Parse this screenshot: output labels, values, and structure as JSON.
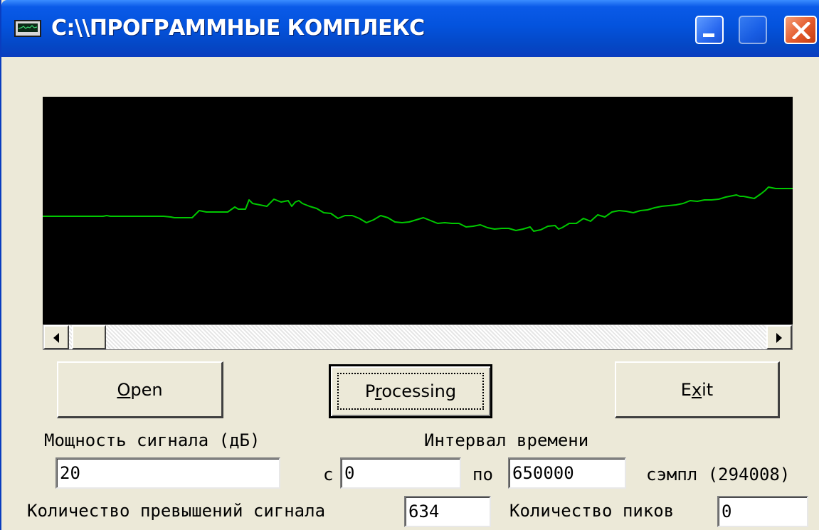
{
  "window": {
    "title": "C:\\\\ПРОГРАММНЫЕ КОМПЛЕКС",
    "icons": {
      "app": "monitor-icon",
      "minimize": "minimize-icon",
      "maximize": "maximize-icon",
      "close": "close-icon"
    },
    "colors": {
      "titlebar": "#0453dd",
      "face": "#ece9d8",
      "close_button": "#e45a2c"
    }
  },
  "plot": {
    "background": "#000000",
    "line_color": "#00c800"
  },
  "chart_data": {
    "type": "line",
    "title": "",
    "xlabel": "",
    "ylabel": "",
    "grid": false,
    "x": [
      0,
      85,
      90,
      95,
      100,
      170,
      180,
      185,
      210,
      220,
      230,
      260,
      270,
      275,
      285,
      290,
      295,
      305,
      315,
      325,
      335,
      345,
      350,
      355,
      360,
      365,
      370,
      375,
      385,
      395,
      405,
      415,
      425,
      435,
      445,
      455,
      465,
      475,
      485,
      495,
      505,
      515,
      525,
      535,
      545,
      555,
      565,
      575,
      585,
      595,
      605,
      615,
      625,
      635,
      645,
      655,
      665,
      675,
      685,
      690,
      700,
      710,
      720,
      725,
      730,
      740,
      750,
      760,
      770,
      780,
      790,
      800,
      810,
      820,
      830,
      840,
      850,
      860,
      870,
      880,
      890,
      900,
      910,
      920,
      930,
      940,
      950,
      960,
      970,
      975,
      980,
      985,
      990,
      1000,
      1010,
      1015,
      1020,
      1030,
      1054
    ],
    "y": [
      168,
      168,
      167,
      168,
      168,
      168,
      169,
      170,
      170,
      160,
      162,
      162,
      155,
      158,
      158,
      145,
      150,
      152,
      154,
      144,
      148,
      146,
      154,
      148,
      146,
      150,
      152,
      154,
      157,
      163,
      164,
      171,
      167,
      167,
      171,
      177,
      173,
      167,
      170,
      176,
      177,
      176,
      173,
      170,
      174,
      178,
      177,
      178,
      178,
      183,
      182,
      180,
      184,
      186,
      185,
      185,
      188,
      186,
      183,
      189,
      187,
      182,
      181,
      186,
      184,
      178,
      178,
      171,
      175,
      166,
      169,
      162,
      160,
      161,
      163,
      160,
      159,
      156,
      154,
      153,
      152,
      150,
      146,
      147,
      145,
      145,
      144,
      141,
      139,
      138,
      140,
      140,
      141,
      143,
      136,
      132,
      127,
      129,
      129
    ]
  },
  "scrollbar": {
    "left_arrow": "left-arrow-icon",
    "right_arrow": "right-arrow-icon"
  },
  "buttons": {
    "open": {
      "accel": "O",
      "rest": "pen"
    },
    "processing": {
      "pre": "P",
      "accel": "r",
      "post": "ocessing"
    },
    "exit": {
      "pre": "E",
      "accel": "x",
      "post": "it"
    }
  },
  "labels": {
    "signal_power": "Мощность сигнала (дБ)",
    "time_interval": "Интервал времени",
    "from": "с",
    "to": "по",
    "samples": "сэмпл (294008)",
    "exceed_count": "Количество превышений сигнала",
    "peak_count": "Количество пиков"
  },
  "fields": {
    "signal_power": "20",
    "from": "0",
    "to": "650000",
    "exceed_count": "634",
    "peak_count": "0"
  }
}
